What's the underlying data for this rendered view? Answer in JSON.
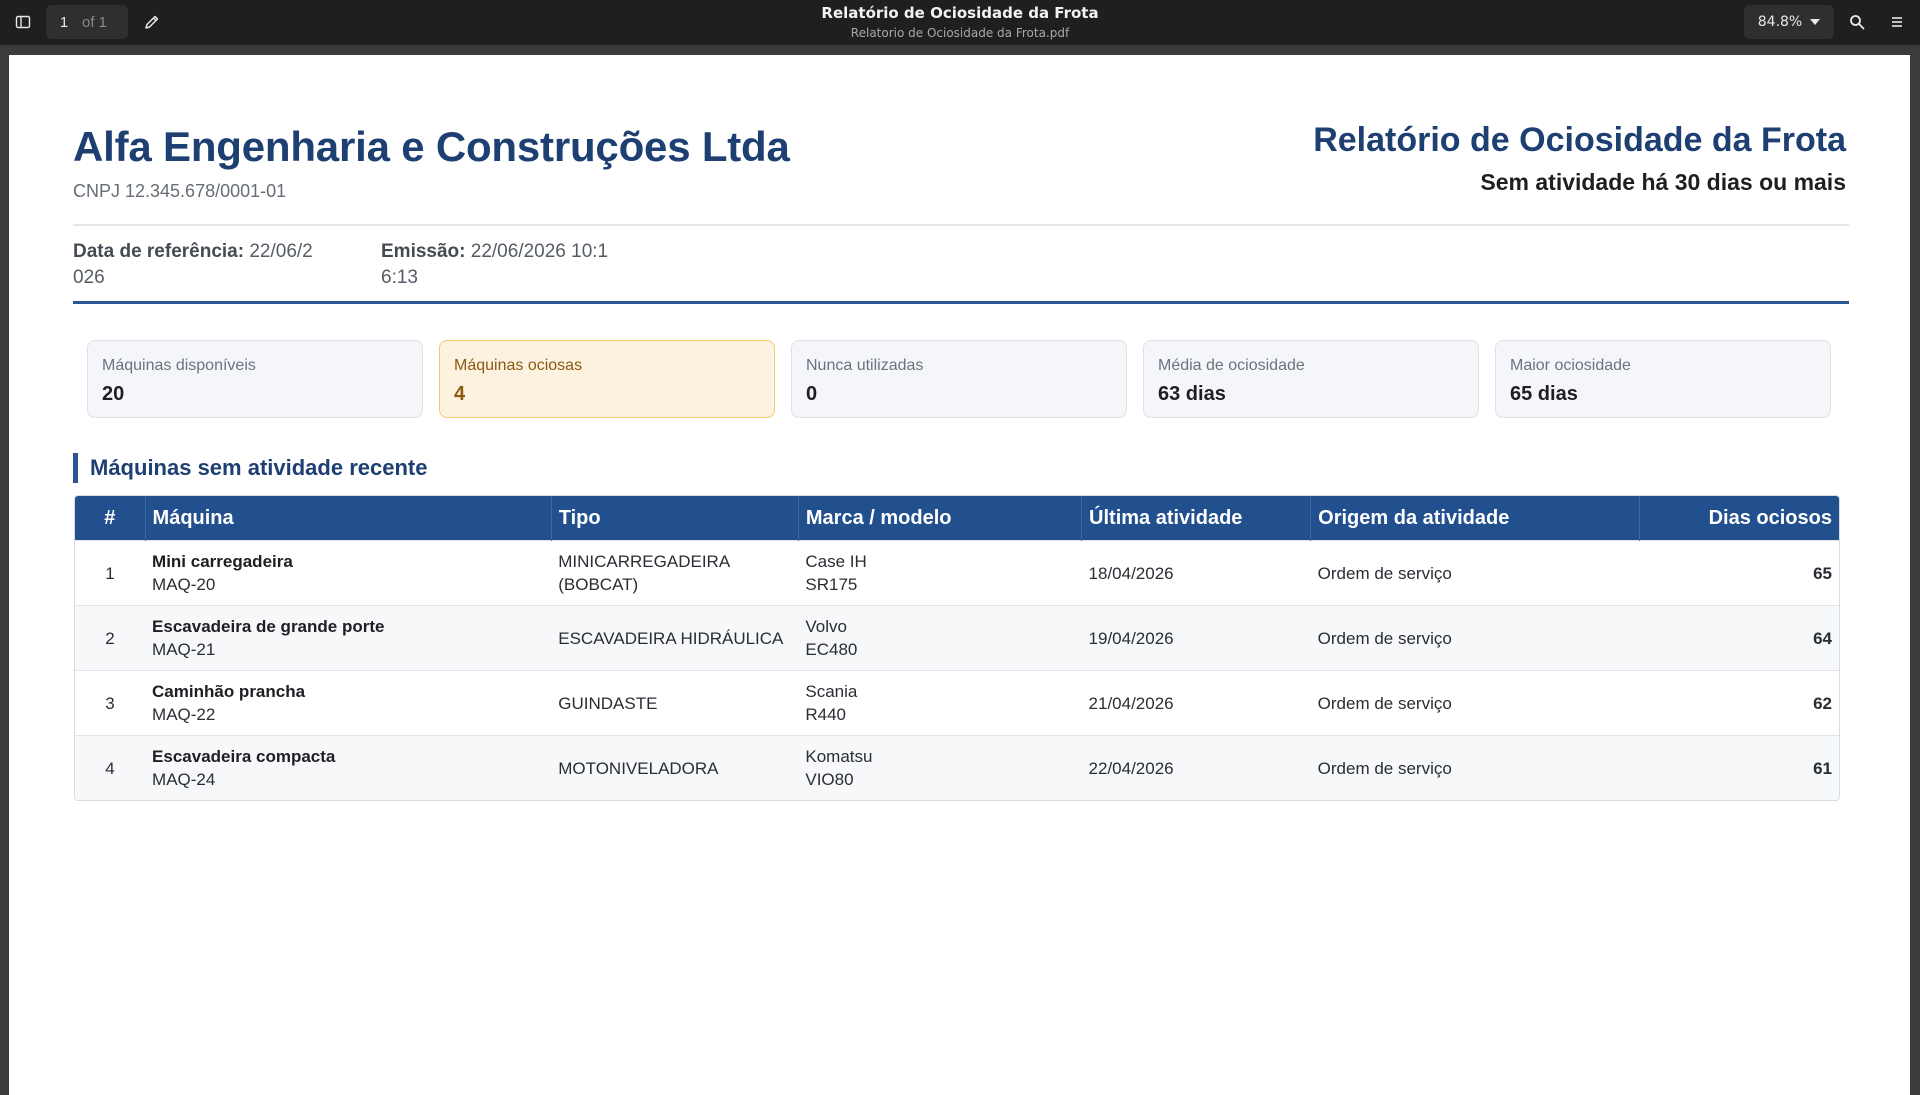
{
  "viewer": {
    "page_current": "1",
    "page_total": "of 1",
    "title": "Relatório de Ociosidade da Frota",
    "filename": "Relatorio de Ociosidade da Frota.pdf",
    "zoom": "84.8%"
  },
  "report": {
    "company": "Alfa Engenharia e Construções Ltda",
    "cnpj": "CNPJ 12.345.678/0001-01",
    "title": "Relatório de Ociosidade da Frota",
    "subtitle": "Sem atividade há 30 dias ou mais",
    "ref_label": "Data de referência:",
    "ref_value": " 22/06/2026",
    "emission_label": "Emissão:",
    "emission_value": " 22/06/2026 10:16:13"
  },
  "kpis": [
    {
      "label": "Máquinas disponíveis",
      "value": "20"
    },
    {
      "label": "Máquinas ociosas",
      "value": "4"
    },
    {
      "label": "Nunca utilizadas",
      "value": "0"
    },
    {
      "label": "Média de ociosidade",
      "value": "63 dias"
    },
    {
      "label": "Maior ociosidade",
      "value": "65 dias"
    }
  ],
  "section_title": "Máquinas sem atividade recente",
  "table": {
    "headers": [
      "#",
      "Máquina",
      "Tipo",
      "Marca / modelo",
      "Última atividade",
      "Origem da atividade",
      "Dias ociosos"
    ],
    "rows": [
      {
        "n": "1",
        "name": "Mini carregadeira",
        "code": "MAQ-20",
        "tipo": "MINICARREGADEIRA (BOBCAT)",
        "marca": "Case IH",
        "modelo": "SR175",
        "ultima": "18/04/2026",
        "origem": "Ordem de serviço",
        "dias": "65"
      },
      {
        "n": "2",
        "name": "Escavadeira de grande porte",
        "code": "MAQ-21",
        "tipo": "ESCAVADEIRA HIDRÁULICA",
        "marca": "Volvo",
        "modelo": "EC480",
        "ultima": "19/04/2026",
        "origem": "Ordem de serviço",
        "dias": "64"
      },
      {
        "n": "3",
        "name": "Caminhão prancha",
        "code": "MAQ-22",
        "tipo": "GUINDASTE",
        "marca": "Scania",
        "modelo": "R440",
        "ultima": "21/04/2026",
        "origem": "Ordem de serviço",
        "dias": "62"
      },
      {
        "n": "4",
        "name": "Escavadeira compacta",
        "code": "MAQ-24",
        "tipo": "MOTONIVELADORA",
        "marca": "Komatsu",
        "modelo": "VIO80",
        "ultima": "22/04/2026",
        "origem": "Ordem de serviço",
        "dias": "61"
      }
    ]
  },
  "icons": {
    "sidebar": "sidebar-toggle-icon",
    "edit": "pencil-icon",
    "search": "search-icon",
    "menu": "hamburger-menu-icon"
  }
}
